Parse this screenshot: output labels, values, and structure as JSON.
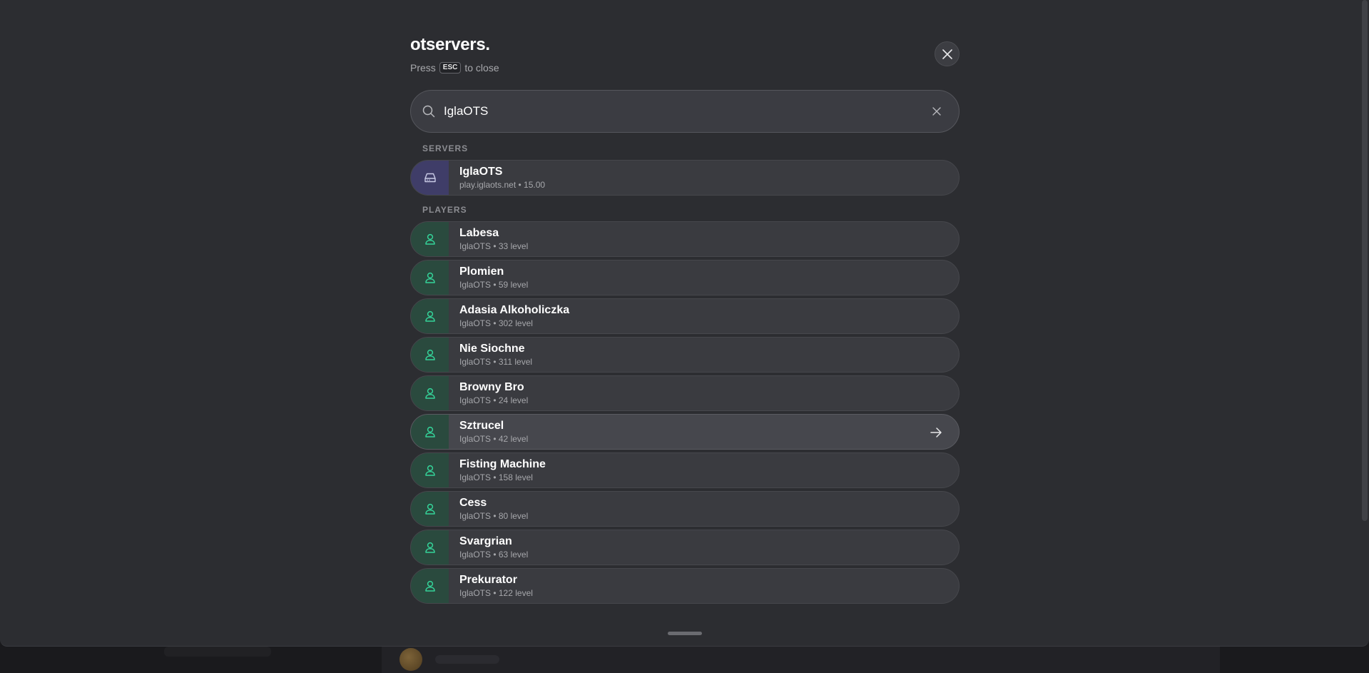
{
  "brand": {
    "name": "otservers."
  },
  "hint": {
    "press": "Press",
    "key": "ESC",
    "rest": "to close"
  },
  "search": {
    "value": "IglaOTS",
    "placeholder": ""
  },
  "icons": {
    "close": "close-icon",
    "search": "search-icon",
    "clear": "clear-icon",
    "server": "hard-drive-icon",
    "player": "user-icon",
    "arrow": "arrow-right-icon"
  },
  "colors": {
    "server_tile": "#3f3d68",
    "player_tile": "#2a4a3e",
    "player_icon": "#34d399",
    "server_icon": "#c9cbe6"
  },
  "sections": {
    "servers_label": "SERVERS",
    "players_label": "PLAYERS"
  },
  "servers": [
    {
      "name": "IglaOTS",
      "sub": "play.iglaots.net • 15.00"
    }
  ],
  "players": [
    {
      "name": "Labesa",
      "sub": "IglaOTS • 33 level"
    },
    {
      "name": "Plomien",
      "sub": "IglaOTS • 59 level"
    },
    {
      "name": "Adasia Alkoholiczka",
      "sub": "IglaOTS • 302 level"
    },
    {
      "name": "Nie Siochne",
      "sub": "IglaOTS • 311 level"
    },
    {
      "name": "Browny Bro",
      "sub": "IglaOTS • 24 level"
    },
    {
      "name": "Sztrucel",
      "sub": "IglaOTS • 42 level",
      "active": true
    },
    {
      "name": "Fisting Machine",
      "sub": "IglaOTS • 158 level"
    },
    {
      "name": "Cess",
      "sub": "IglaOTS • 80 level"
    },
    {
      "name": "Svargrian",
      "sub": "IglaOTS • 63 level"
    },
    {
      "name": "Prekurator",
      "sub": "IglaOTS • 122 level"
    }
  ]
}
